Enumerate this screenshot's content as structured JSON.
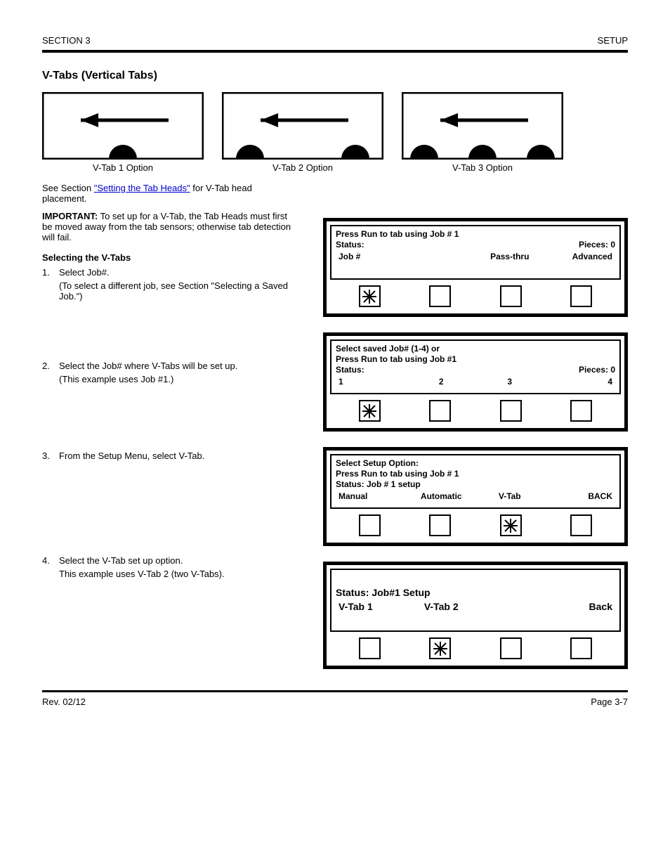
{
  "header": {
    "left": "SECTION 3",
    "right": "SETUP"
  },
  "section_title": "V-Tabs (Vertical Tabs)",
  "diagrams": [
    {
      "label": "V-Tab 1 Option"
    },
    {
      "label": "V-Tab 2 Option"
    },
    {
      "label": "V-Tab 3 Option"
    }
  ],
  "intro": {
    "see": "See Section ",
    "link": "\"Setting the Tab Heads\"",
    "after": " for V-Tab head placement.",
    "important": "IMPORTANT:",
    "important_text": " To set up for a V-Tab, the Tab Heads must first be moved away from the tab sensors; otherwise tab detection will fail."
  },
  "steps_title": "Selecting the V-Tabs",
  "steps": [
    {
      "num": "1.",
      "text": "Select Job#.",
      "sub": "(To select a different job, see Section \"Selecting a Saved Job.\")"
    },
    {
      "num": "2.",
      "text": "Select the Job# where V-Tabs will be set up.",
      "sub": "(This example uses Job #1.)"
    },
    {
      "num": "3.",
      "text": "From the Setup Menu, select V-Tab.",
      "sub": ""
    },
    {
      "num": "4.",
      "text": "Select the V-Tab set up option.",
      "sub": "This example uses V-Tab 2 (two V-Tabs)."
    }
  ],
  "panels": [
    {
      "lines": [
        "Press Run to tab using Job # 1",
        {
          "left": "Status:",
          "right": "Pieces: 0"
        }
      ],
      "bottom": [
        "Job #",
        "",
        "Pass-thru",
        "Advanced"
      ],
      "selected": 0
    },
    {
      "lines": [
        "Select saved Job# (1-4) or",
        "Press Run to tab using Job #1",
        {
          "left": "Status:",
          "right": "Pieces: 0"
        }
      ],
      "bottom": [
        "1",
        "2",
        "3",
        "4"
      ],
      "selected": 0
    },
    {
      "lines": [
        "Select Setup Option:",
        "Press Run to tab using Job # 1",
        "Status: Job # 1 setup"
      ],
      "bottom": [
        "Manual",
        "Automatic",
        "V-Tab",
        "BACK"
      ],
      "selected": 2
    },
    {
      "large": true,
      "lines": [
        "Status: Job#1 Setup"
      ],
      "bottom": [
        "V-Tab 1",
        "V-Tab 2",
        "",
        "Back"
      ],
      "selected": 1
    }
  ],
  "footer": {
    "rev": "Rev. 02/12",
    "page": "Page 3-7"
  }
}
